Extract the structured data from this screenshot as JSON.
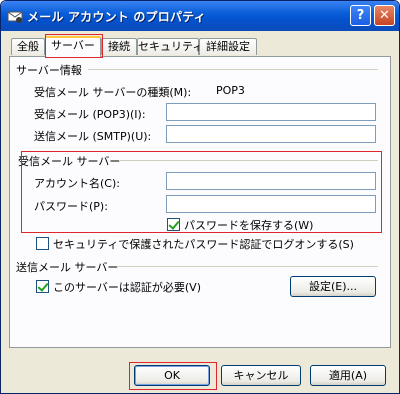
{
  "window": {
    "title": "メール アカウント のプロパティ",
    "help_glyph": "?",
    "close_glyph": "✕"
  },
  "tabs": [
    {
      "label": "全般",
      "active": false
    },
    {
      "label": "サーバー",
      "active": true
    },
    {
      "label": "接続",
      "active": false
    },
    {
      "label": "セキュリティ",
      "active": false
    },
    {
      "label": "詳細設定",
      "active": false
    }
  ],
  "server_info": {
    "group_label": "サーバー情報",
    "type_label": "受信メール サーバーの種類(M):",
    "type_value": "POP3",
    "incoming_label": "受信メール (POP3)(I):",
    "incoming_value": "",
    "outgoing_label": "送信メール (SMTP)(U):",
    "outgoing_value": ""
  },
  "incoming_server": {
    "group_label": "受信メール サーバー",
    "account_label": "アカウント名(C):",
    "account_value": "",
    "password_label": "パスワード(P):",
    "password_value": "",
    "save_password_label": "パスワードを保存する(W)",
    "save_password_checked": true
  },
  "spa_label": "セキュリティで保護されたパスワード認証でログオンする(S)",
  "spa_checked": false,
  "outgoing_server": {
    "group_label": "送信メール サーバー",
    "auth_label": "このサーバーは認証が必要(V)",
    "auth_checked": true,
    "settings_button": "設定(E)..."
  },
  "footer": {
    "ok": "OK",
    "cancel": "キャンセル",
    "apply": "適用(A)"
  },
  "colors": {
    "highlight": "#e0262d",
    "title_bar": "#0a5fd8",
    "dialog_bg": "#ece9d8"
  }
}
